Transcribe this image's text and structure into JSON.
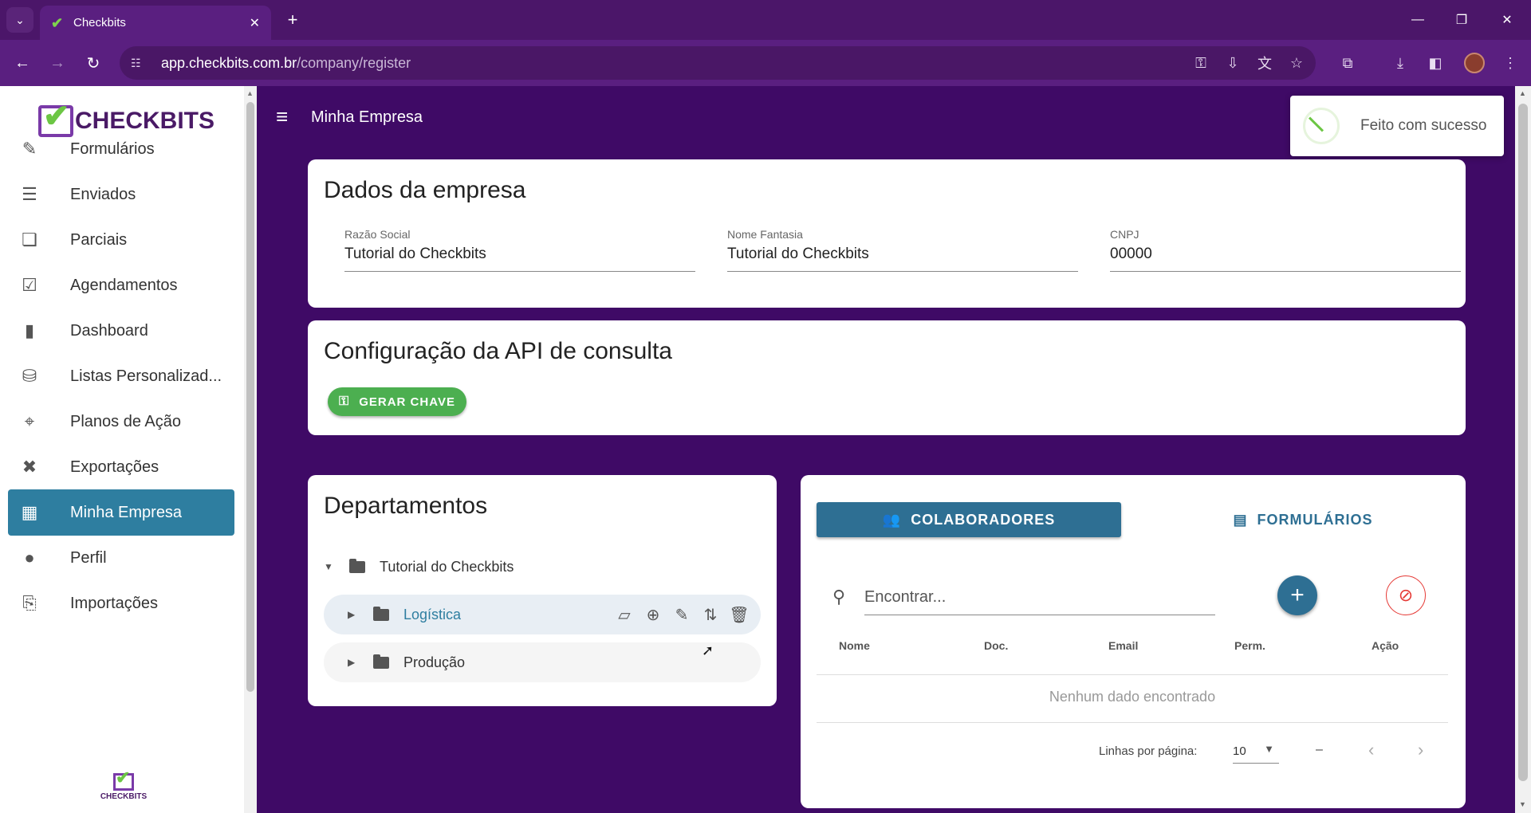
{
  "browser": {
    "tab_title": "Checkbits",
    "url_host": "app.checkbits.com.br",
    "url_path": "/company/register"
  },
  "sidebar": {
    "logo_text": "CHECKBITS",
    "bottom_logo_text": "CHECKBITS",
    "items": [
      {
        "label": "Formulários",
        "icon": "form-icon"
      },
      {
        "label": "Enviados",
        "icon": "sent-list-icon"
      },
      {
        "label": "Parciais",
        "icon": "partial-docs-icon"
      },
      {
        "label": "Agendamentos",
        "icon": "calendar-check-icon"
      },
      {
        "label": "Dashboard",
        "icon": "bar-chart-icon"
      },
      {
        "label": "Listas Personalizad...",
        "icon": "database-icon"
      },
      {
        "label": "Planos de Ação",
        "icon": "crosshair-icon"
      },
      {
        "label": "Exportações",
        "icon": "excel-file-icon"
      },
      {
        "label": "Minha Empresa",
        "icon": "building-icon",
        "active": true
      },
      {
        "label": "Perfil",
        "icon": "person-icon"
      },
      {
        "label": "Importações",
        "icon": "file-import-icon"
      }
    ]
  },
  "header": {
    "title": "Minha Empresa"
  },
  "toast": {
    "message": "Feito com sucesso"
  },
  "company": {
    "title": "Dados da empresa",
    "razao_label": "Razão Social",
    "razao_value": "Tutorial do Checkbits",
    "fantasia_label": "Nome Fantasia",
    "fantasia_value": "Tutorial do Checkbits",
    "cnpj_label": "CNPJ",
    "cnpj_value": "00000"
  },
  "api": {
    "title": "Configuração da API de consulta",
    "button_label": "GERAR CHAVE"
  },
  "departments": {
    "title": "Departamentos",
    "root": "Tutorial do Checkbits",
    "children": [
      "Logística",
      "Produção"
    ]
  },
  "collab": {
    "tab_collaborators": "COLABORADORES",
    "tab_forms": "FORMULÁRIOS",
    "search_placeholder": "Encontrar...",
    "columns": [
      "Nome",
      "Doc.",
      "Email",
      "Perm.",
      "Ação"
    ],
    "empty_text": "Nenhum dado encontrado",
    "rows_per_page_label": "Linhas por página:",
    "rows_per_page_value": "10",
    "range_text": "–"
  },
  "colors": {
    "page_bg": "#3f0a66",
    "accent": "#2e6f93",
    "success": "#4caf50",
    "active_nav": "#2e7ea0"
  }
}
